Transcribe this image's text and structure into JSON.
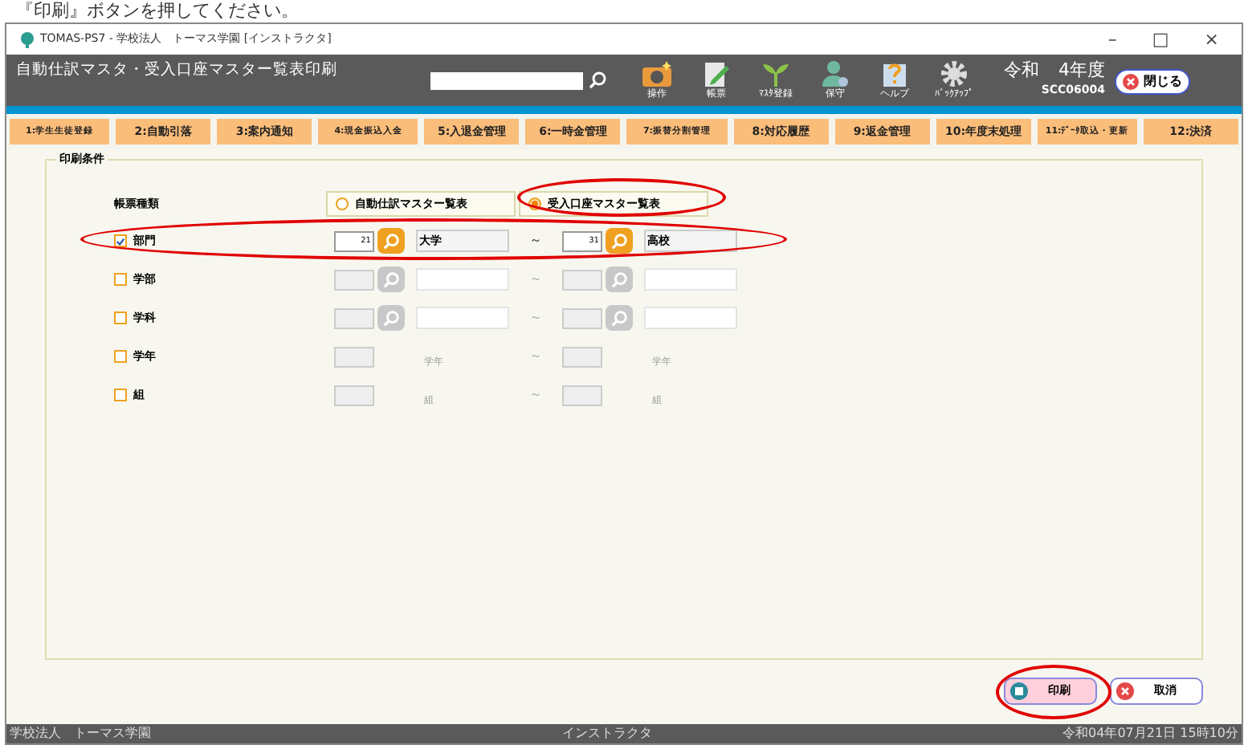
{
  "instruction": "『印刷』ボタンを押してください。",
  "window": {
    "title": "TOMAS-PS7 - 学校法人　トーマス学園 [インストラクタ]",
    "controls": [
      "–",
      "□",
      "×"
    ]
  },
  "header": {
    "title": "自動仕訳マスタ・受入口座マスター覧表印刷",
    "search_field": true,
    "tools": [
      {
        "kind": "camera",
        "label": "操作"
      },
      {
        "kind": "form",
        "label": "帳票"
      },
      {
        "kind": "sprout",
        "label": "ﾏｽﾀ登録"
      },
      {
        "kind": "person",
        "label": "保守"
      },
      {
        "kind": "help",
        "label": "ヘルプ"
      },
      {
        "kind": "gear",
        "label": "ﾊﾞｯｸｱｯﾌﾟ"
      }
    ],
    "era": "令和",
    "year": "4年度",
    "code": "SCC06004",
    "close": "閉じる"
  },
  "tabs": [
    {
      "label": "1:学生生徒登録",
      "small": true
    },
    {
      "label": "2:自動引落",
      "small": false
    },
    {
      "label": "3:案内通知",
      "small": false
    },
    {
      "label": "4:現金振込入金",
      "small": true
    },
    {
      "label": "5:入退金管理",
      "small": false
    },
    {
      "label": "6:一時金管理",
      "small": false
    },
    {
      "label": "7:振替分割管理",
      "small": true
    },
    {
      "label": "8:対応履歴",
      "small": false
    },
    {
      "label": "9:返金管理",
      "small": false
    },
    {
      "label": "10:年度末処理",
      "small": false
    },
    {
      "label": "11:ﾃﾞｰﾀ取込・更新",
      "small": true
    },
    {
      "label": "12:決済",
      "small": false
    }
  ],
  "conditions": {
    "title": "印刷条件",
    "report_type": {
      "label": "帳票種類",
      "options": [
        {
          "label": "自動仕訳マスター覧表",
          "selected": false
        },
        {
          "label": "受入口座マスター覧表",
          "selected": true
        }
      ]
    },
    "rows": [
      {
        "kind": "lookup",
        "label": "部門",
        "checked": true,
        "from": "21",
        "from_name": "大学",
        "tilde": "～",
        "to": "31",
        "to_name": "高校"
      },
      {
        "kind": "lookup",
        "label": "学部",
        "checked": false,
        "from": "",
        "from_name": "",
        "tilde": "～",
        "to": "",
        "to_name": ""
      },
      {
        "kind": "lookup",
        "label": "学科",
        "checked": false,
        "from": "",
        "from_name": "",
        "tilde": "～",
        "to": "",
        "to_name": ""
      },
      {
        "kind": "plain",
        "label": "学年",
        "checked": false,
        "from": "",
        "from_name": "学年",
        "tilde": "～",
        "to": "",
        "to_name": "学年"
      },
      {
        "kind": "plain",
        "label": "組",
        "checked": false,
        "from": "",
        "from_name": "組",
        "tilde": "～",
        "to": "",
        "to_name": "組"
      }
    ]
  },
  "buttons": [
    {
      "kind": "print",
      "label": "印刷"
    },
    {
      "kind": "cancel",
      "label": "取消"
    }
  ],
  "status_bar": {
    "left": "学校法人　トーマス学園",
    "center": "インストラクタ",
    "right": "令和04年07月21日 15時10分"
  }
}
